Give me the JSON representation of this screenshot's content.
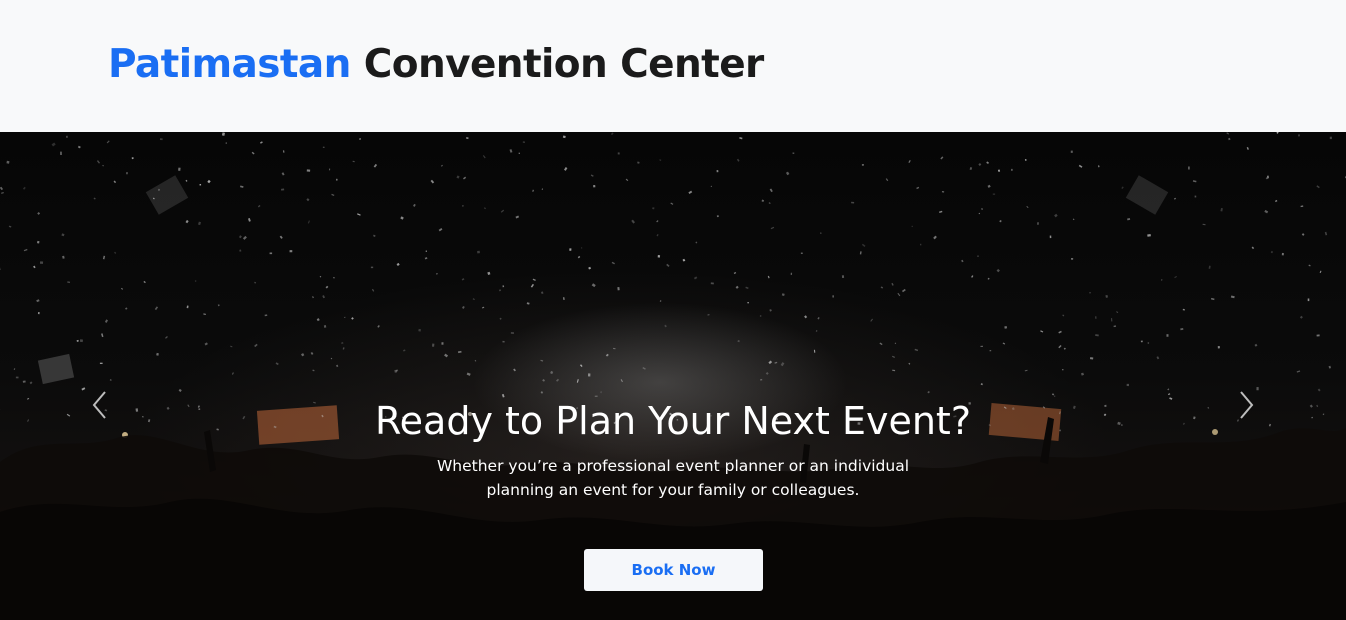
{
  "header": {
    "brand_accent": "Patimastan",
    "brand_rest": "Convention Center"
  },
  "hero": {
    "title": "Ready to Plan Your Next Event?",
    "subtitle": "Whether you’re a professional event planner or an individual planning an event for your family or colleagues.",
    "cta_label": "Book Now"
  },
  "colors": {
    "accent": "#1a6ef3",
    "brand_dark": "#1b1b1b",
    "header_bg": "#f8f9fa",
    "button_bg": "#f5f7fa"
  },
  "icons": {
    "prev": "chevron-left-icon",
    "next": "chevron-right-icon"
  }
}
